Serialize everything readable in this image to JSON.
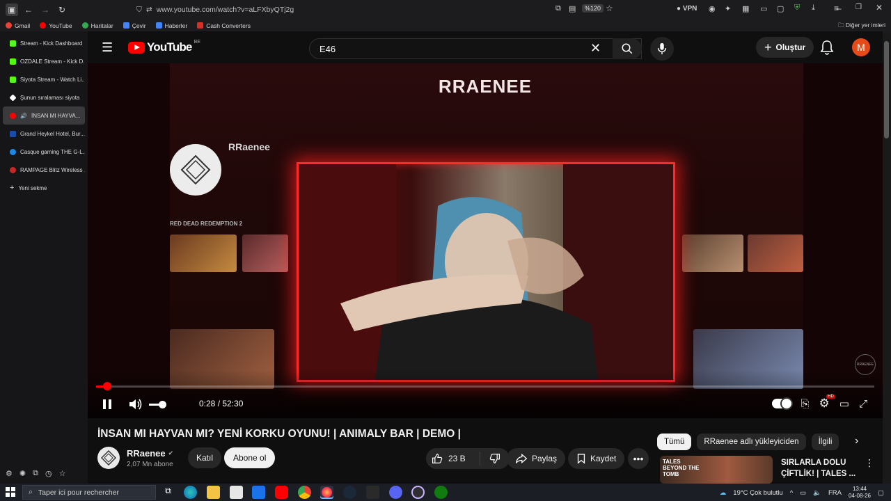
{
  "browser": {
    "url": "www.youtube.com/watch?v=aLFXbyQTj2g",
    "zoom": "%120",
    "vpn_label": "VPN",
    "bookmarks": [
      {
        "label": "Gmail",
        "color": "#ea4335"
      },
      {
        "label": "YouTube",
        "color": "#ff0000"
      },
      {
        "label": "Haritalar",
        "color": "#34a853"
      },
      {
        "label": "Çevir",
        "color": "#4285f4"
      },
      {
        "label": "Haberler",
        "color": "#4285f4"
      },
      {
        "label": "Cash Converters",
        "color": "#d93025"
      }
    ],
    "other_bookmarks": "Diğer yer imleri"
  },
  "sidebar": {
    "tabs": [
      {
        "label": "Stream - Kick Dashboard",
        "color": "#53fc18",
        "active": false
      },
      {
        "label": "OZDALE Stream - Kick D...",
        "color": "#53fc18",
        "active": false
      },
      {
        "label": "Siyota Stream - Watch Li...",
        "color": "#53fc18",
        "active": false
      },
      {
        "label": "Şunun sıralaması siyota",
        "color": "#ffffff",
        "active": false
      },
      {
        "label": "İNSAN MI HAYVA...",
        "color": "#ff0000",
        "active": true
      },
      {
        "label": "Grand Heykel Hotel, Bur...",
        "color": "#1a4ba8",
        "active": false
      },
      {
        "label": "Casque gaming THE G-L...",
        "color": "#1e88e5",
        "active": false
      },
      {
        "label": "RAMPAGE Blitz Wireless ...",
        "color": "#c62828",
        "active": false
      }
    ],
    "new_tab": "Yeni sekme"
  },
  "header": {
    "logo_text": "YouTube",
    "country": "BE",
    "search_value": "E46",
    "create_label": "Oluştur",
    "avatar_letter": "M"
  },
  "player": {
    "banner_channel": "RRAENEE",
    "mini_channel": "RRaenee",
    "mini_section": "RED DEAD REDEMPTION 2",
    "current_time": "0:28",
    "duration": "52:30",
    "time_display": "0:28 / 52:30",
    "progress_fraction": 0.009,
    "volume_fraction": 0.3,
    "watermark": "RRAENEE"
  },
  "video": {
    "title": "İNSAN MI HAYVAN MI? YENİ KORKU OYUNU! | ANIMALY BAR | DEMO |",
    "channel_name": "RRaenee",
    "subscribers": "2,07 Mn abone",
    "join_label": "Katıl",
    "subscribe_label": "Abone ol",
    "likes": "23 B",
    "share_label": "Paylaş",
    "save_label": "Kaydet"
  },
  "related": {
    "chips": [
      {
        "label": "Tümü",
        "selected": true
      },
      {
        "label": "RRaenee adlı yükleyiciden",
        "selected": false
      },
      {
        "label": "İlgili",
        "selected": false
      }
    ],
    "first_video_title": "SIRLARLA DOLU ÇİFTLİK! | TALES ...",
    "thumb_text": "TALES BEYOND THE TOMB"
  },
  "taskbar": {
    "search_placeholder": "Taper ici pour rechercher",
    "weather": "19°C Çok bulutlu",
    "language": "FRA",
    "time": "13:44",
    "date": "04-08-26"
  },
  "colors": {
    "accent": "#ff0000",
    "yt_bg": "#0f0f0f",
    "button_bg": "#272727"
  }
}
